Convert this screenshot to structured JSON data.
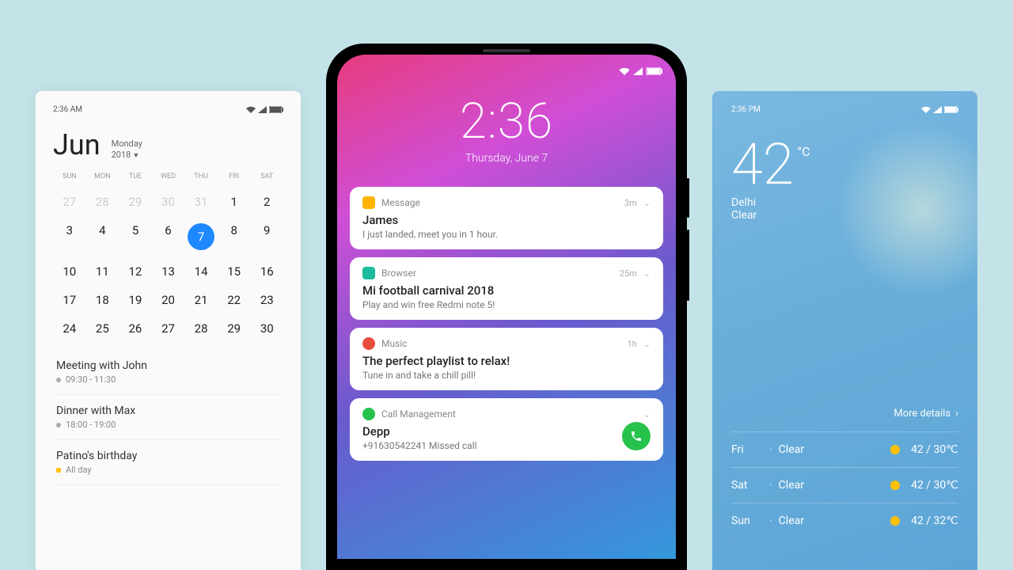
{
  "calendar": {
    "status_time": "2:36 AM",
    "month": "Jun",
    "weekday": "Monday",
    "year": "2018",
    "dow": [
      "SUN",
      "MON",
      "TUE",
      "WED",
      "THU",
      "FRI",
      "SAT"
    ],
    "weeks": [
      [
        "27",
        "28",
        "29",
        "30",
        "31",
        "1",
        "2"
      ],
      [
        "3",
        "4",
        "5",
        "6",
        "7",
        "8",
        "9"
      ],
      [
        "10",
        "11",
        "12",
        "13",
        "14",
        "15",
        "16"
      ],
      [
        "17",
        "18",
        "19",
        "20",
        "21",
        "22",
        "23"
      ],
      [
        "24",
        "25",
        "26",
        "27",
        "28",
        "29",
        "30"
      ]
    ],
    "today": "7",
    "events": [
      {
        "title": "Meeting with John",
        "time": "09:30 - 11:30",
        "color": "gray"
      },
      {
        "title": "Dinner with Max",
        "time": "18:00 - 19:00",
        "color": "gray"
      },
      {
        "title": "Patino's birthday",
        "time": "All day",
        "color": "yellow"
      }
    ]
  },
  "lockscreen": {
    "time": "2:36",
    "date": "Thursday, June 7",
    "notifications": [
      {
        "app": "Message",
        "icon": "#ffb300",
        "ago": "3m",
        "title": "James",
        "body": "I just landed, meet you in 1 hour."
      },
      {
        "app": "Browser",
        "icon": "#1bbc9b",
        "ago": "25m",
        "title": "Mi football carnival 2018",
        "body": "Play and win free Redmi note 5!"
      },
      {
        "app": "Music",
        "icon": "#e74c3c",
        "ago": "1h",
        "title": "The perfect playlist to relax!",
        "body": "Tune in and take a chill pill!"
      },
      {
        "app": "Call Management",
        "icon": "#27c24c",
        "ago": "",
        "title": "Depp",
        "body": "+91630542241 Missed call",
        "call": true
      }
    ]
  },
  "weather": {
    "status_time": "2:36 PM",
    "temp": "42",
    "unit": "°C",
    "location": "Delhi",
    "condition": "Clear",
    "more": "More details",
    "forecast": [
      {
        "day": "Fri",
        "cond": "Clear",
        "hi": "42",
        "lo": "30",
        "u": "℃"
      },
      {
        "day": "Sat",
        "cond": "Clear",
        "hi": "42",
        "lo": "30",
        "u": "℃"
      },
      {
        "day": "Sun",
        "cond": "Clear",
        "hi": "42",
        "lo": "32",
        "u": "℃"
      }
    ]
  }
}
